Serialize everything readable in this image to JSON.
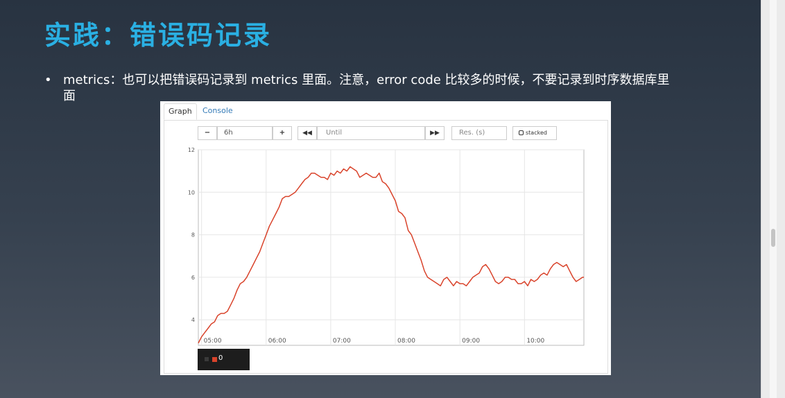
{
  "slide": {
    "title": "实践：错误码记录",
    "bullet_symbol": "•",
    "bullet_text": "metrics：也可以把错误码记录到 metrics 里面。注意，error code 比较多的时候，不要记录到时序数据库里面"
  },
  "prometheus": {
    "tabs": [
      "Graph",
      "Console"
    ],
    "controls": {
      "minus_label": "−",
      "range_value": "6h",
      "plus_label": "+",
      "back_label": "◀◀",
      "until_placeholder": "Until",
      "forward_label": "▶▶",
      "res_placeholder": "Res. (s)",
      "stacked_label": "stacked"
    },
    "legend": {
      "series_label": "0",
      "series_color": "#d9432b"
    }
  },
  "chart_data": {
    "type": "line",
    "title": "",
    "xlabel": "",
    "ylabel": "",
    "x_ticks": [
      "05:00",
      "06:00",
      "07:00",
      "08:00",
      "09:00",
      "10:00"
    ],
    "y_ticks": [
      4,
      6,
      8,
      10,
      12
    ],
    "xlim": [
      4.95,
      10.92
    ],
    "ylim": [
      2.8,
      12
    ],
    "grid": true,
    "series": [
      {
        "name": "0",
        "color": "#d9432b",
        "x": [
          4.95,
          5.0,
          5.05,
          5.1,
          5.15,
          5.2,
          5.25,
          5.3,
          5.35,
          5.4,
          5.45,
          5.5,
          5.55,
          5.6,
          5.65,
          5.7,
          5.75,
          5.8,
          5.85,
          5.9,
          5.95,
          6.0,
          6.05,
          6.1,
          6.15,
          6.2,
          6.25,
          6.3,
          6.35,
          6.4,
          6.45,
          6.5,
          6.55,
          6.6,
          6.65,
          6.7,
          6.75,
          6.8,
          6.85,
          6.9,
          6.95,
          7.0,
          7.05,
          7.1,
          7.15,
          7.2,
          7.25,
          7.3,
          7.35,
          7.4,
          7.45,
          7.5,
          7.55,
          7.6,
          7.65,
          7.7,
          7.75,
          7.8,
          7.85,
          7.9,
          7.95,
          8.0,
          8.05,
          8.1,
          8.15,
          8.2,
          8.25,
          8.3,
          8.35,
          8.4,
          8.45,
          8.5,
          8.55,
          8.6,
          8.65,
          8.7,
          8.75,
          8.8,
          8.85,
          8.9,
          8.95,
          9.0,
          9.05,
          9.1,
          9.15,
          9.2,
          9.25,
          9.3,
          9.35,
          9.4,
          9.45,
          9.5,
          9.55,
          9.6,
          9.65,
          9.7,
          9.75,
          9.8,
          9.85,
          9.9,
          9.95,
          10.0,
          10.05,
          10.1,
          10.15,
          10.2,
          10.25,
          10.3,
          10.35,
          10.4,
          10.45,
          10.5,
          10.55,
          10.6,
          10.65,
          10.7,
          10.75,
          10.8,
          10.85,
          10.9,
          10.92
        ],
        "y": [
          2.9,
          3.2,
          3.4,
          3.6,
          3.8,
          3.9,
          4.2,
          4.3,
          4.3,
          4.4,
          4.7,
          5.0,
          5.4,
          5.7,
          5.8,
          6.0,
          6.3,
          6.6,
          6.9,
          7.2,
          7.6,
          8.0,
          8.4,
          8.7,
          9.0,
          9.3,
          9.7,
          9.8,
          9.8,
          9.9,
          10.0,
          10.2,
          10.4,
          10.6,
          10.7,
          10.9,
          10.9,
          10.8,
          10.7,
          10.7,
          10.6,
          10.9,
          10.8,
          11.0,
          10.9,
          11.1,
          11.0,
          11.2,
          11.1,
          11.0,
          10.7,
          10.8,
          10.9,
          10.8,
          10.7,
          10.7,
          10.9,
          10.5,
          10.4,
          10.2,
          9.9,
          9.6,
          9.1,
          9.0,
          8.8,
          8.2,
          8.0,
          7.6,
          7.2,
          6.8,
          6.3,
          6.0,
          5.9,
          5.8,
          5.7,
          5.6,
          5.9,
          6.0,
          5.8,
          5.6,
          5.8,
          5.7,
          5.7,
          5.6,
          5.8,
          6.0,
          6.1,
          6.2,
          6.5,
          6.6,
          6.4,
          6.1,
          5.8,
          5.7,
          5.8,
          6.0,
          6.0,
          5.9,
          5.9,
          5.7,
          5.7,
          5.8,
          5.6,
          5.9,
          5.8,
          5.9,
          6.1,
          6.2,
          6.1,
          6.4,
          6.6,
          6.7,
          6.6,
          6.5,
          6.6,
          6.3,
          6.0,
          5.8,
          5.9,
          6.0,
          6.0
        ]
      }
    ]
  }
}
